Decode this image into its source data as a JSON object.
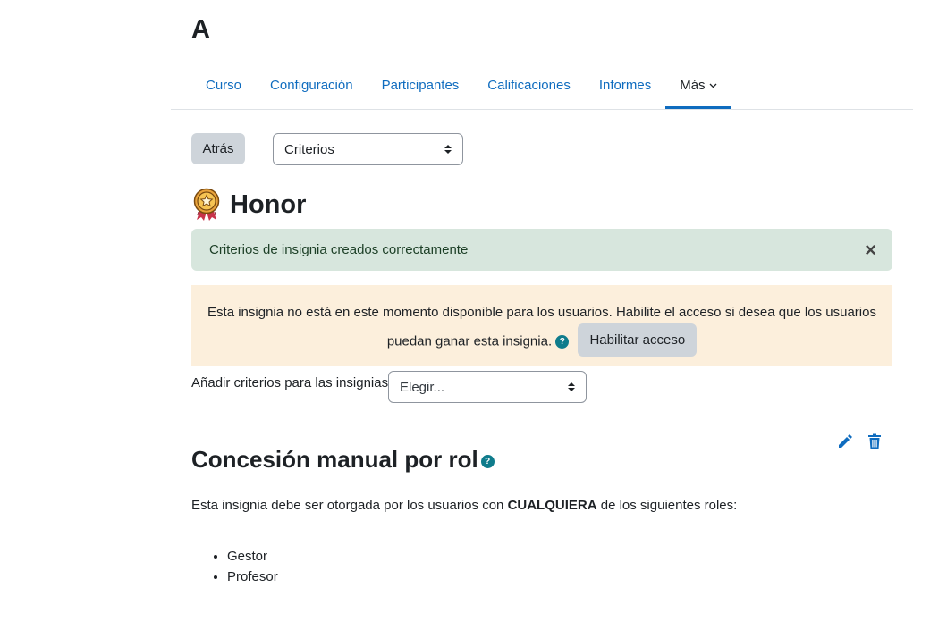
{
  "course": {
    "title": "A"
  },
  "tabs": [
    {
      "label": "Curso"
    },
    {
      "label": "Configuración"
    },
    {
      "label": "Participantes"
    },
    {
      "label": "Calificaciones"
    },
    {
      "label": "Informes"
    },
    {
      "label": "Más",
      "active": true
    }
  ],
  "toolbar": {
    "back_label": "Atrás",
    "criteria_select": "Criterios"
  },
  "badge": {
    "name": "Honor",
    "icon": "medal-icon"
  },
  "alert_success": {
    "text": "Criterios de insignia creados correctamente",
    "close": "×"
  },
  "alert_warning": {
    "text": "Esta insignia no está en este momento disponible para los usuarios. Habilite el acceso si desea que los usuarios puedan ganar esta insignia.",
    "button_label": "Habilitar acceso"
  },
  "add_criteria": {
    "label": "Añadir criterios para las insignias",
    "select_value": "Elegir..."
  },
  "criterion": {
    "title": "Concesión manual por rol",
    "desc_before": "Esta insignia debe ser otorgada por los usuarios con ",
    "desc_strong": "CUALQUIERA",
    "desc_after": " de los siguientes roles:",
    "roles": [
      "Gestor",
      "Profesor"
    ]
  },
  "help_glyph": "?",
  "colors": {
    "link": "#0f6cbf",
    "success_bg": "#d7e6dd",
    "warning_bg": "#fcefdc",
    "help": "#0f7c8c"
  }
}
